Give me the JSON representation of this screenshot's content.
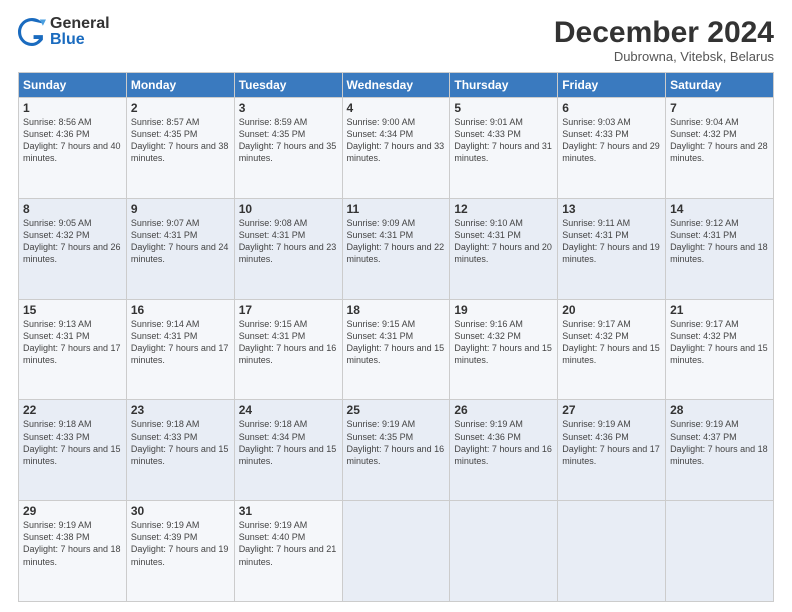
{
  "logo": {
    "general": "General",
    "blue": "Blue"
  },
  "title": "December 2024",
  "location": "Dubrowna, Vitebsk, Belarus",
  "days_header": [
    "Sunday",
    "Monday",
    "Tuesday",
    "Wednesday",
    "Thursday",
    "Friday",
    "Saturday"
  ],
  "weeks": [
    [
      {
        "day": "1",
        "sunrise": "8:56 AM",
        "sunset": "4:36 PM",
        "daylight": "7 hours and 40 minutes."
      },
      {
        "day": "2",
        "sunrise": "8:57 AM",
        "sunset": "4:35 PM",
        "daylight": "7 hours and 38 minutes."
      },
      {
        "day": "3",
        "sunrise": "8:59 AM",
        "sunset": "4:35 PM",
        "daylight": "7 hours and 35 minutes."
      },
      {
        "day": "4",
        "sunrise": "9:00 AM",
        "sunset": "4:34 PM",
        "daylight": "7 hours and 33 minutes."
      },
      {
        "day": "5",
        "sunrise": "9:01 AM",
        "sunset": "4:33 PM",
        "daylight": "7 hours and 31 minutes."
      },
      {
        "day": "6",
        "sunrise": "9:03 AM",
        "sunset": "4:33 PM",
        "daylight": "7 hours and 29 minutes."
      },
      {
        "day": "7",
        "sunrise": "9:04 AM",
        "sunset": "4:32 PM",
        "daylight": "7 hours and 28 minutes."
      }
    ],
    [
      {
        "day": "8",
        "sunrise": "9:05 AM",
        "sunset": "4:32 PM",
        "daylight": "7 hours and 26 minutes."
      },
      {
        "day": "9",
        "sunrise": "9:07 AM",
        "sunset": "4:31 PM",
        "daylight": "7 hours and 24 minutes."
      },
      {
        "day": "10",
        "sunrise": "9:08 AM",
        "sunset": "4:31 PM",
        "daylight": "7 hours and 23 minutes."
      },
      {
        "day": "11",
        "sunrise": "9:09 AM",
        "sunset": "4:31 PM",
        "daylight": "7 hours and 22 minutes."
      },
      {
        "day": "12",
        "sunrise": "9:10 AM",
        "sunset": "4:31 PM",
        "daylight": "7 hours and 20 minutes."
      },
      {
        "day": "13",
        "sunrise": "9:11 AM",
        "sunset": "4:31 PM",
        "daylight": "7 hours and 19 minutes."
      },
      {
        "day": "14",
        "sunrise": "9:12 AM",
        "sunset": "4:31 PM",
        "daylight": "7 hours and 18 minutes."
      }
    ],
    [
      {
        "day": "15",
        "sunrise": "9:13 AM",
        "sunset": "4:31 PM",
        "daylight": "7 hours and 17 minutes."
      },
      {
        "day": "16",
        "sunrise": "9:14 AM",
        "sunset": "4:31 PM",
        "daylight": "7 hours and 17 minutes."
      },
      {
        "day": "17",
        "sunrise": "9:15 AM",
        "sunset": "4:31 PM",
        "daylight": "7 hours and 16 minutes."
      },
      {
        "day": "18",
        "sunrise": "9:15 AM",
        "sunset": "4:31 PM",
        "daylight": "7 hours and 15 minutes."
      },
      {
        "day": "19",
        "sunrise": "9:16 AM",
        "sunset": "4:32 PM",
        "daylight": "7 hours and 15 minutes."
      },
      {
        "day": "20",
        "sunrise": "9:17 AM",
        "sunset": "4:32 PM",
        "daylight": "7 hours and 15 minutes."
      },
      {
        "day": "21",
        "sunrise": "9:17 AM",
        "sunset": "4:32 PM",
        "daylight": "7 hours and 15 minutes."
      }
    ],
    [
      {
        "day": "22",
        "sunrise": "9:18 AM",
        "sunset": "4:33 PM",
        "daylight": "7 hours and 15 minutes."
      },
      {
        "day": "23",
        "sunrise": "9:18 AM",
        "sunset": "4:33 PM",
        "daylight": "7 hours and 15 minutes."
      },
      {
        "day": "24",
        "sunrise": "9:18 AM",
        "sunset": "4:34 PM",
        "daylight": "7 hours and 15 minutes."
      },
      {
        "day": "25",
        "sunrise": "9:19 AM",
        "sunset": "4:35 PM",
        "daylight": "7 hours and 16 minutes."
      },
      {
        "day": "26",
        "sunrise": "9:19 AM",
        "sunset": "4:36 PM",
        "daylight": "7 hours and 16 minutes."
      },
      {
        "day": "27",
        "sunrise": "9:19 AM",
        "sunset": "4:36 PM",
        "daylight": "7 hours and 17 minutes."
      },
      {
        "day": "28",
        "sunrise": "9:19 AM",
        "sunset": "4:37 PM",
        "daylight": "7 hours and 18 minutes."
      }
    ],
    [
      {
        "day": "29",
        "sunrise": "9:19 AM",
        "sunset": "4:38 PM",
        "daylight": "7 hours and 18 minutes."
      },
      {
        "day": "30",
        "sunrise": "9:19 AM",
        "sunset": "4:39 PM",
        "daylight": "7 hours and 19 minutes."
      },
      {
        "day": "31",
        "sunrise": "9:19 AM",
        "sunset": "4:40 PM",
        "daylight": "7 hours and 21 minutes."
      },
      null,
      null,
      null,
      null
    ]
  ]
}
